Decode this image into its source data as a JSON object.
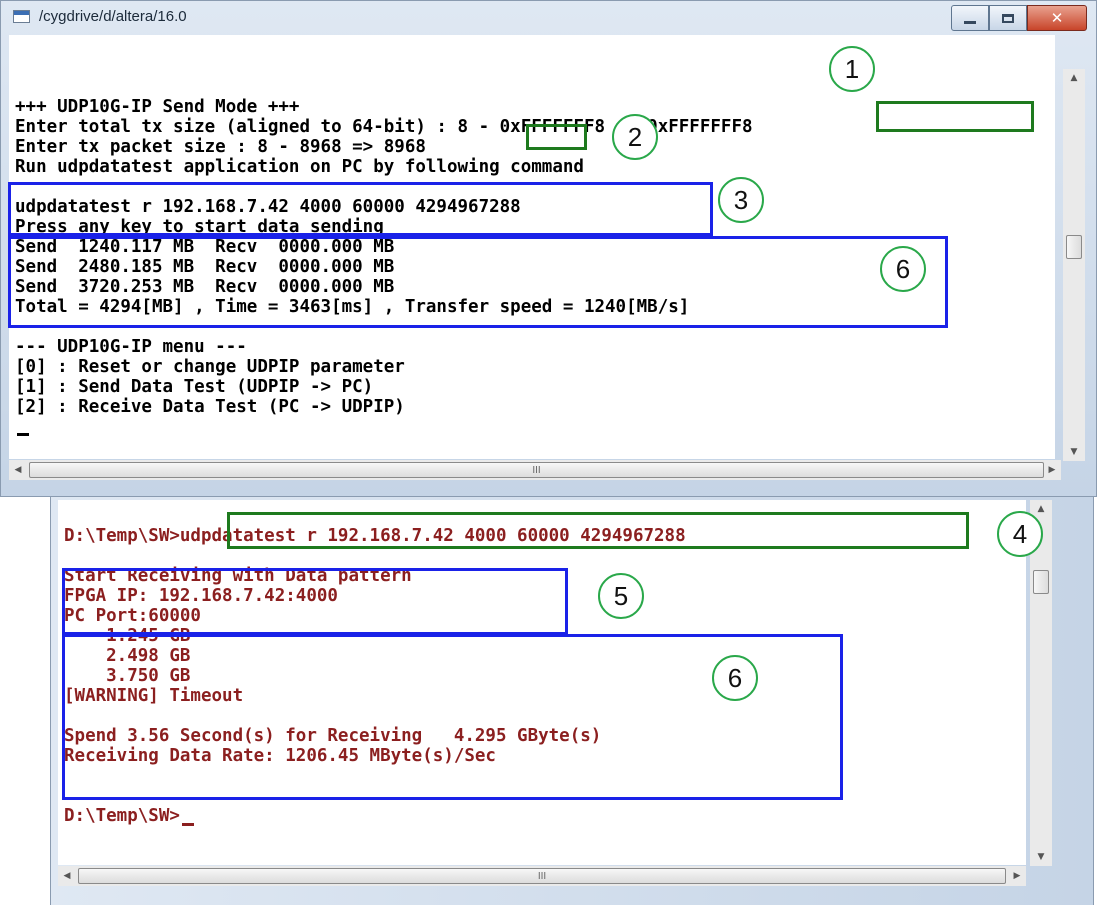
{
  "window_top": {
    "title": "/cygdrive/d/altera/16.0",
    "lines": [
      "",
      "+++ UDP10G-IP Send Mode +++",
      "Enter total tx size (aligned to 64-bit) : 8 - 0xFFFFFFF8 => 0xFFFFFFF8",
      "Enter tx packet size : 8 - 8968 => 8968",
      "Run udpdatatest application on PC by following command",
      "",
      "udpdatatest r 192.168.7.42 4000 60000 4294967288",
      "Press any key to start data sending",
      "Send  1240.117 MB  Recv  0000.000 MB",
      "Send  2480.185 MB  Recv  0000.000 MB",
      "Send  3720.253 MB  Recv  0000.000 MB",
      "Total = 4294[MB] , Time = 3463[ms] , Transfer speed = 1240[MB/s]",
      "",
      "--- UDP10G-IP menu ---",
      "[0] : Reset or change UDPIP parameter",
      "[1] : Send Data Test (UDPIP -> PC)",
      "[2] : Receive Data Test (PC -> UDPIP)"
    ]
  },
  "window_bottom": {
    "lines": [
      "",
      "D:\\Temp\\SW>udpdatatest r 192.168.7.42 4000 60000 4294967288",
      "",
      "Start Receiving with Data pattern",
      "FPGA IP: 192.168.7.42:4000",
      "PC Port:60000",
      "    1.245 GB",
      "    2.498 GB",
      "    3.750 GB",
      "[WARNING] Timeout",
      "",
      "Spend 3.56 Second(s) for Receiving   4.295 GByte(s)",
      "Receiving Data Rate: 1206.45 MByte(s)/Sec",
      "",
      "",
      "D:\\Temp\\SW>"
    ]
  },
  "callouts": [
    "1",
    "2",
    "3",
    "6",
    "4",
    "5",
    "6"
  ],
  "scroll_grip": "III",
  "colors": {
    "highlight_green": "#1e7a1e",
    "highlight_blue": "#1a22e8",
    "callout_ring": "#2aa84a",
    "bottom_console_text": "#8b1f1f"
  },
  "icons": [
    "app-icon",
    "minimize-icon",
    "maximize-icon",
    "close-icon",
    "scroll-up-icon",
    "scroll-down-icon",
    "scroll-left-icon",
    "scroll-right-icon"
  ]
}
